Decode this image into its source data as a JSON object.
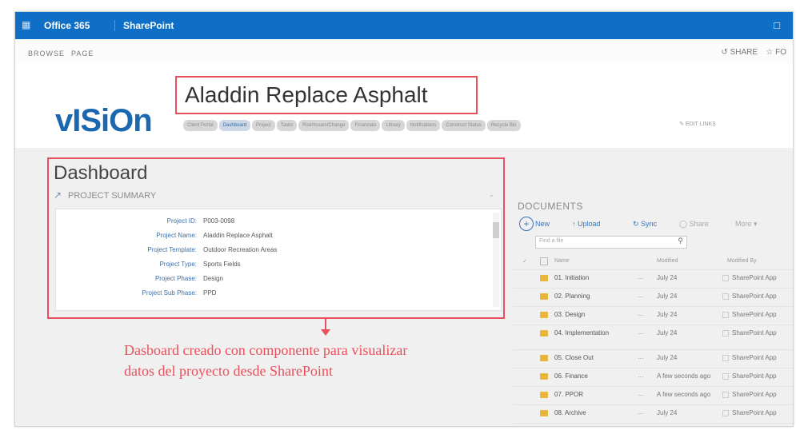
{
  "suite_bar": {
    "app_launcher_icon": "waffle-icon",
    "product": "Office 365",
    "app": "SharePoint",
    "notifications_icon": "bell-icon",
    "color": "#0f6fc6"
  },
  "ribbon": {
    "tabs": [
      "BROWSE",
      "PAGE"
    ],
    "share_label": "SHARE",
    "follow_label": "FO"
  },
  "site": {
    "logo": "vISiOn",
    "title": "Aladdin Replace Asphalt",
    "nav": [
      "Client Portal",
      "Dashboard",
      "Project",
      "Tasks",
      "Risk/Issues/Change",
      "Financials",
      "Library",
      "Notifications",
      "Construct Status",
      "Recycle Bin"
    ],
    "selected_nav": "Dashboard",
    "edit_links": "EDIT LINKS"
  },
  "dashboard": {
    "heading": "Dashboard",
    "panel_title": "PROJECT SUMMARY",
    "fields": [
      {
        "label": "Project ID:",
        "value": "P003-0098"
      },
      {
        "label": "Project Name:",
        "value": "Aladdin Replace Asphalt"
      },
      {
        "label": "Project Template:",
        "value": "Outdoor Recreation Areas"
      },
      {
        "label": "Project Type:",
        "value": "Sports Fields"
      },
      {
        "label": "Project Phase:",
        "value": "Design"
      },
      {
        "label": "Project Sub Phase:",
        "value": "PPD"
      }
    ]
  },
  "annotation": {
    "text_line1": "Dasboard creado con componente para visualizar",
    "text_line2": "datos del proyecto desde SharePoint",
    "color": "#e8505b"
  },
  "documents": {
    "title": "DOCUMENTS",
    "commands": [
      "New",
      "Upload",
      "Sync",
      "Share",
      "More"
    ],
    "search_placeholder": "Find a file",
    "columns": [
      "Name",
      "Modified",
      "Modified By"
    ],
    "rows": [
      {
        "name": "01. Initiation",
        "modified": "July 24",
        "modified_by": "SharePoint App"
      },
      {
        "name": "02. Planning",
        "modified": "July 24",
        "modified_by": "SharePoint App"
      },
      {
        "name": "03. Design",
        "modified": "July 24",
        "modified_by": "SharePoint App"
      },
      {
        "name": "04. Implementation",
        "modified": "July 24",
        "modified_by": "SharePoint App"
      },
      {
        "name": "05. Close Out",
        "modified": "July 24",
        "modified_by": "SharePoint App"
      },
      {
        "name": "06. Finance",
        "modified": "A few seconds ago",
        "modified_by": "SharePoint App"
      },
      {
        "name": "07. PPOR",
        "modified": "A few seconds ago",
        "modified_by": "SharePoint App"
      },
      {
        "name": "08. Archive",
        "modified": "July 24",
        "modified_by": "SharePoint App"
      }
    ]
  }
}
